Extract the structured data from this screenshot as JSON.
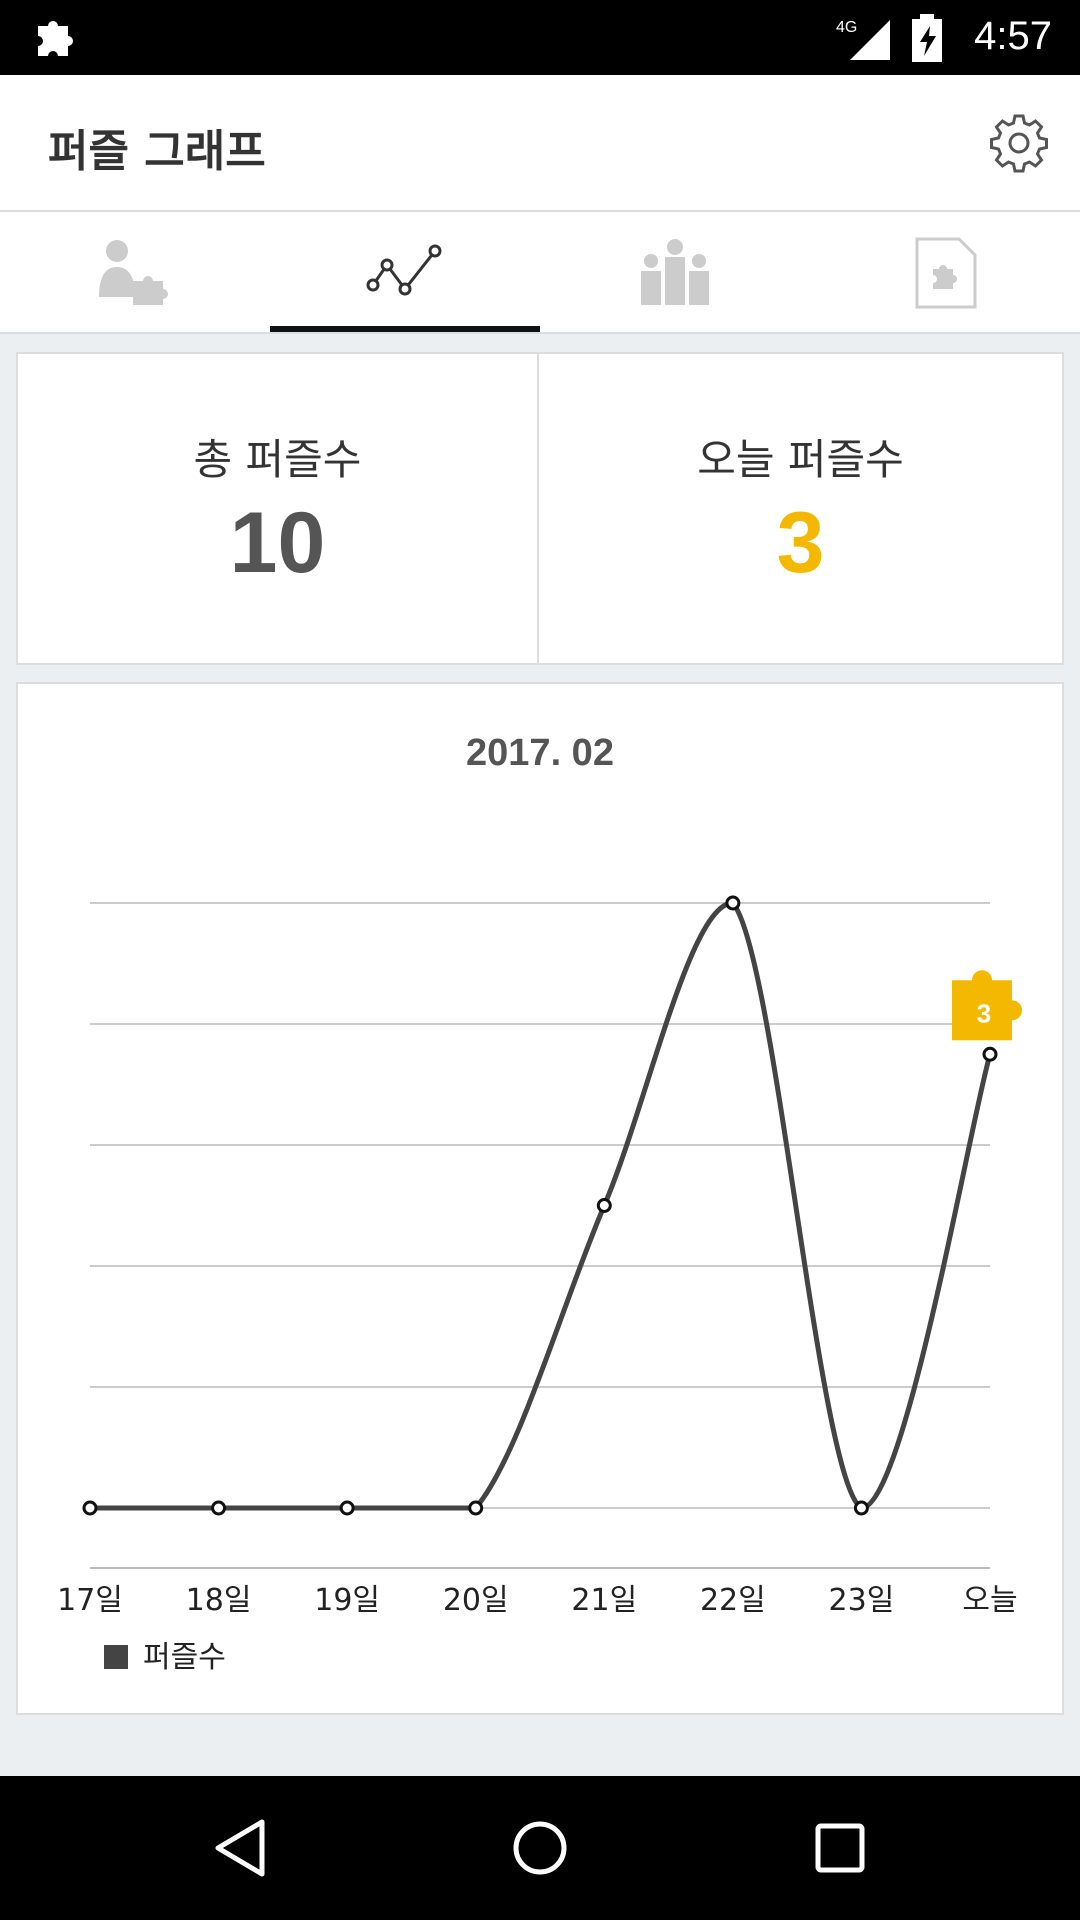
{
  "status_bar": {
    "time": "4:57",
    "network": "4G"
  },
  "app_bar": {
    "title": "퍼즐 그래프"
  },
  "tabs": [
    {
      "name": "profile-puzzle",
      "selected": false
    },
    {
      "name": "graph",
      "selected": true
    },
    {
      "name": "ranking",
      "selected": false
    },
    {
      "name": "puzzle-document",
      "selected": false
    }
  ],
  "stats": {
    "total_label": "총 퍼즐수",
    "total_value": "10",
    "today_label": "오늘 퍼즐수",
    "today_value": "3"
  },
  "colors": {
    "accent": "#f5b800",
    "line": "#444444",
    "total": "#555555"
  },
  "chart_data": {
    "type": "line",
    "title": "2017. 02",
    "categories": [
      "17일",
      "18일",
      "19일",
      "20일",
      "21일",
      "22일",
      "23일",
      "오늘"
    ],
    "series": [
      {
        "name": "퍼즐수",
        "values": [
          0,
          0,
          0,
          0,
          2.5,
          5,
          0,
          3.75
        ]
      }
    ],
    "ylim": [
      0,
      5
    ],
    "grid": true,
    "legend": "bottom-left",
    "today_badge": "3"
  }
}
